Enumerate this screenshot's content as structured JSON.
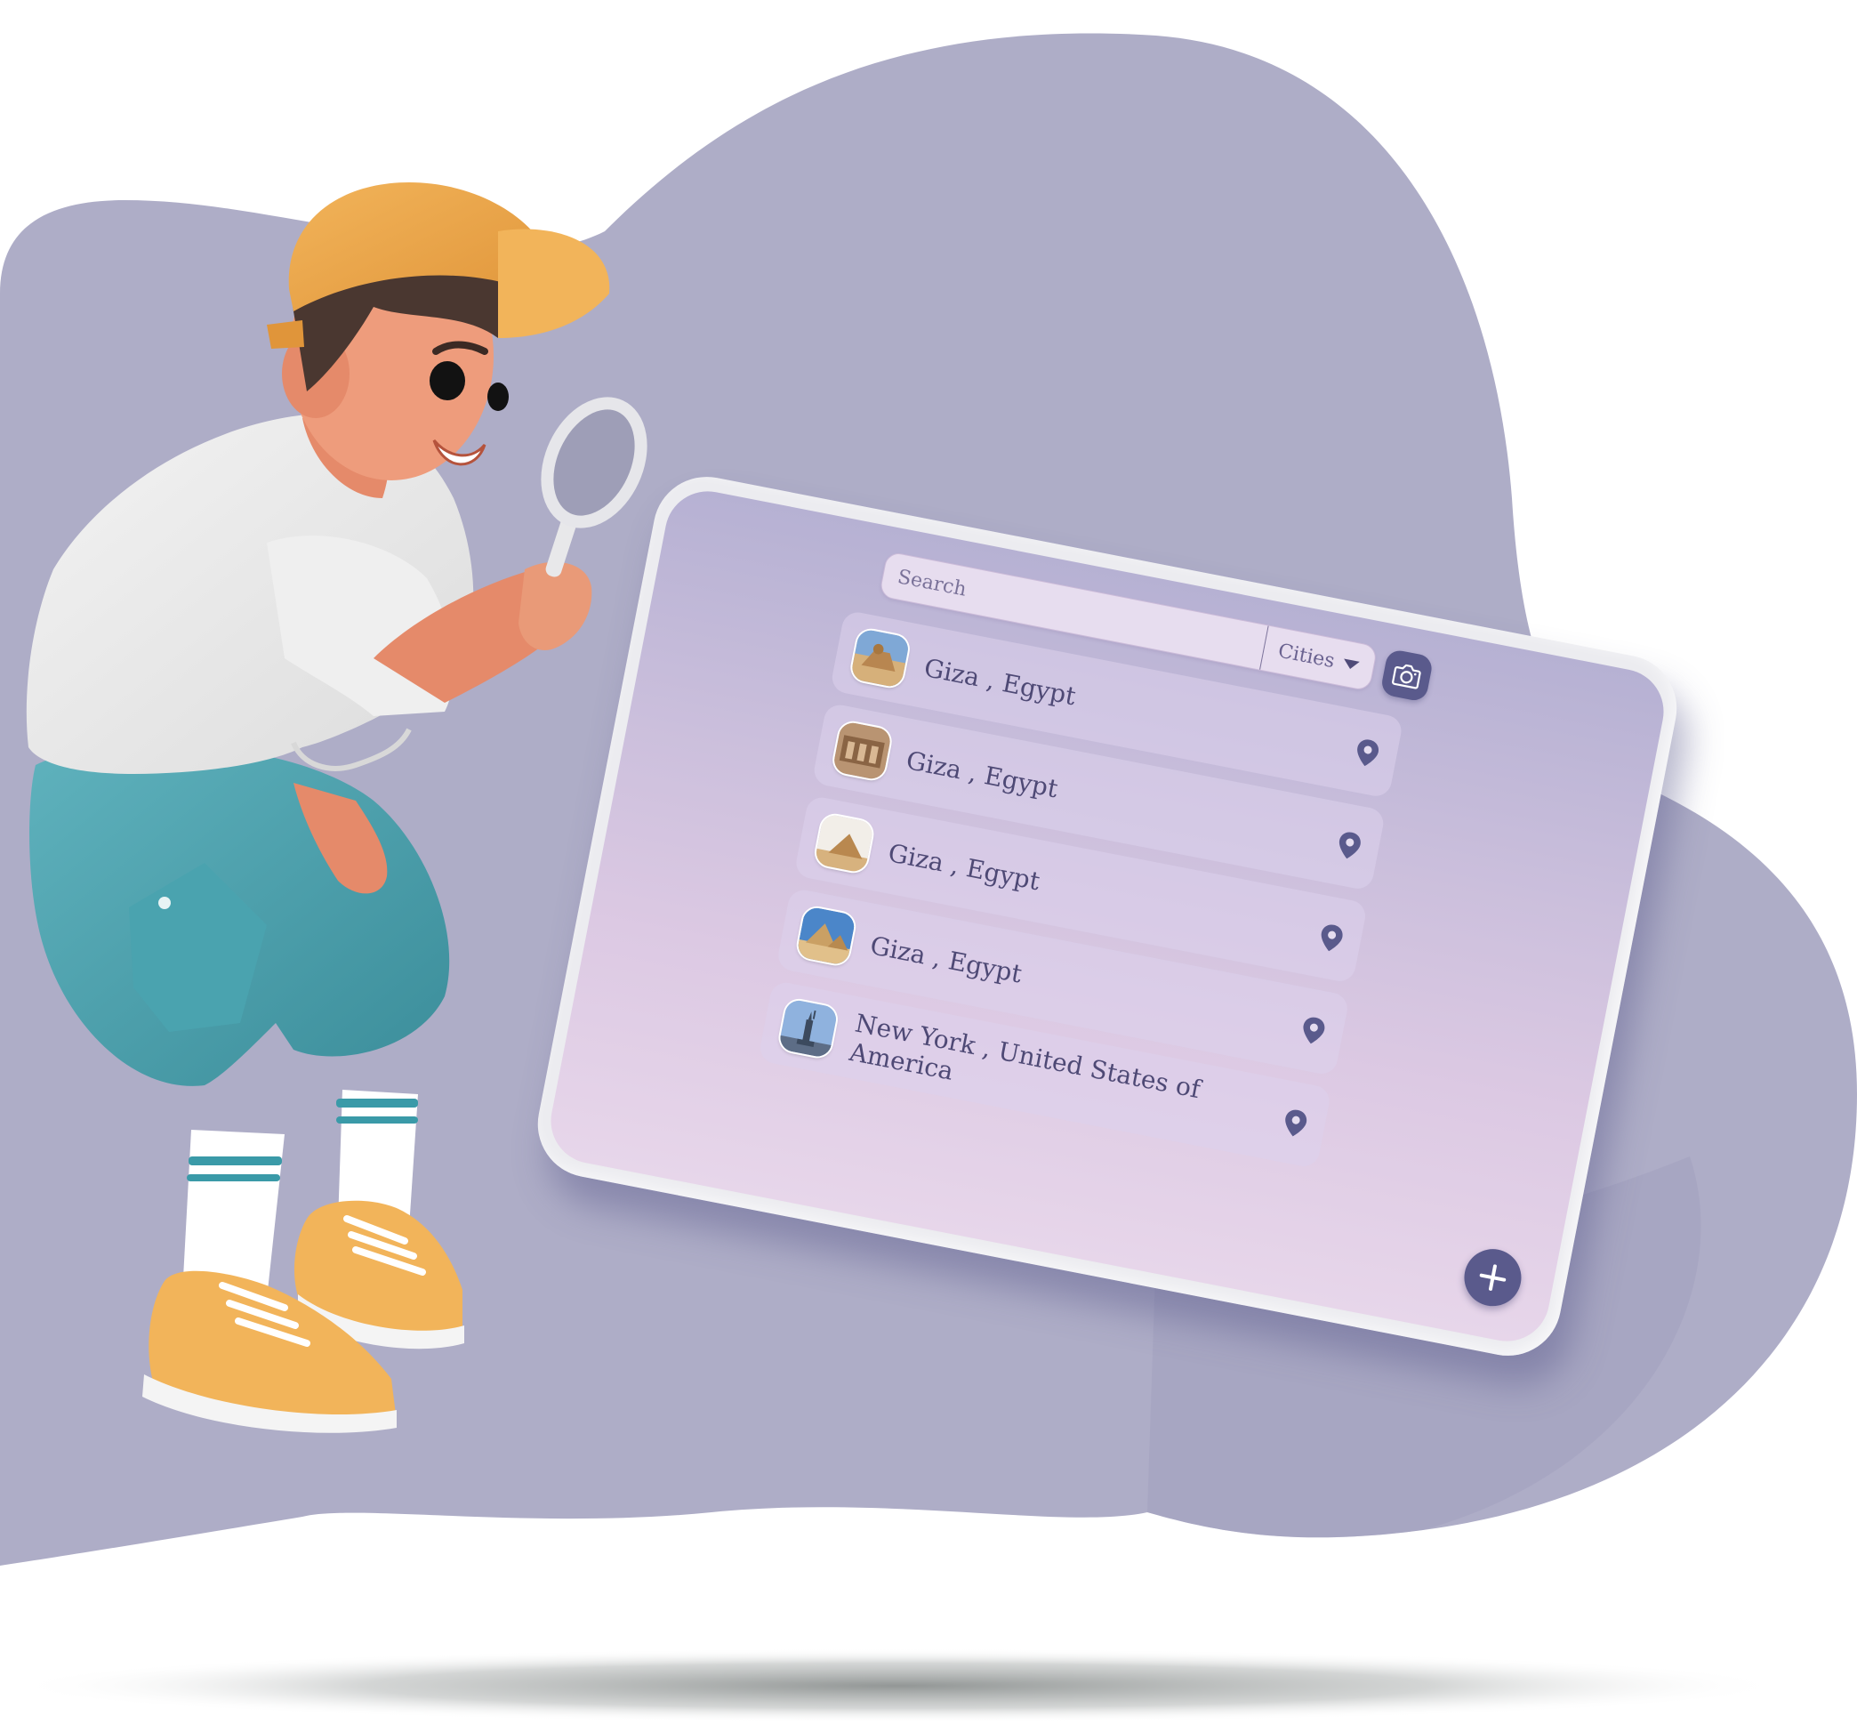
{
  "colors": {
    "blob": "#aeadc7",
    "accent": "#5a5a8c",
    "screen_top": "#b6b1d3",
    "screen_bottom": "#e7d6ea",
    "text": "#4e4975"
  },
  "search": {
    "placeholder": "Search",
    "value": "",
    "icon": "camera-icon"
  },
  "filter": {
    "selected": "Cities",
    "icon": "chevron-down-icon"
  },
  "results": [
    {
      "label": "Giza , Egypt",
      "thumbnail": "sphinx",
      "icon": "map-pin-icon"
    },
    {
      "label": "Giza , Egypt",
      "thumbnail": "ruins",
      "icon": "map-pin-icon"
    },
    {
      "label": "Giza , Egypt",
      "thumbnail": "pyramid-white-sky",
      "icon": "map-pin-icon"
    },
    {
      "label": "Giza , Egypt",
      "thumbnail": "pyramids-blue-sky",
      "icon": "map-pin-icon"
    },
    {
      "label": "New York , United States of America",
      "thumbnail": "statue-of-liberty",
      "icon": "map-pin-icon"
    }
  ],
  "fab": {
    "icon": "plus-icon"
  }
}
